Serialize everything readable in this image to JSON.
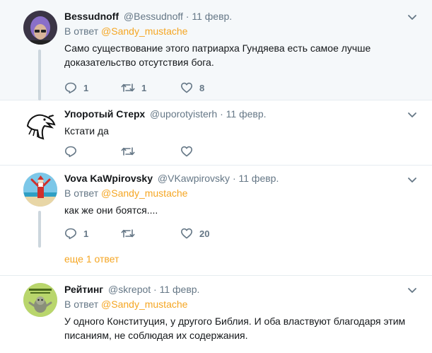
{
  "tweets": [
    {
      "fullname": "Bessudnoff",
      "handle": "@Bessudnoff",
      "separator": "·",
      "time": "11 февр.",
      "reply_prefix": "В ответ",
      "reply_mention": "@Sandy_mustache",
      "text": "Само существование этого патриарха Гундяева есть самое лучше доказательство отсутствия бога.",
      "reply_count": "1",
      "retweet_count": "1",
      "like_count": "8",
      "avatar": "purple-haired-person-avatar"
    },
    {
      "fullname": "Упоротый Стерх",
      "handle": "@uporotyisterh",
      "separator": "·",
      "time": "11 февр.",
      "text": "Кстати да",
      "reply_count": "",
      "retweet_count": "",
      "like_count": "",
      "avatar": "crane-bird-sketch-avatar"
    },
    {
      "fullname": "Vova KaWpirovsky",
      "handle": "@VKawpirovsky",
      "separator": "·",
      "time": "11 февр.",
      "reply_prefix": "В ответ",
      "reply_mention": "@Sandy_mustache",
      "text": "как же они боятся....",
      "reply_count": "1",
      "retweet_count": "",
      "like_count": "20",
      "more_replies": "еще 1 ответ",
      "avatar": "santa-on-beach-avatar"
    },
    {
      "fullname": "Рейтинг",
      "handle": "@skrepot",
      "separator": "·",
      "time": "11 февр.",
      "reply_prefix": "В ответ",
      "reply_mention": "@Sandy_mustache",
      "text": "У одного Конституция, у другого Библия. И оба властвуют благодаря этим писаниям, не соблюдая их содержания.",
      "avatar": "green-cartoon-avatar"
    }
  ],
  "colors": {
    "accent": "#f5a623",
    "muted": "#657786",
    "highlight_bg": "#f5f8fa",
    "divider": "#e6ecf0"
  }
}
